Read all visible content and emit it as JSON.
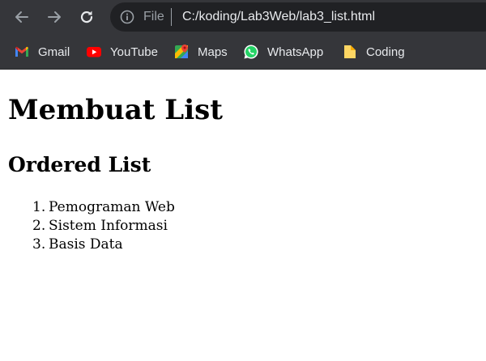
{
  "browser": {
    "scheme_label": "File",
    "url": "C:/koding/Lab3Web/lab3_list.html",
    "nav": {
      "back_icon": "arrow-left-icon",
      "forward_icon": "arrow-right-icon",
      "reload_icon": "reload-icon"
    },
    "bookmarks": [
      {
        "label": "Gmail",
        "icon": "gmail-icon"
      },
      {
        "label": "YouTube",
        "icon": "youtube-icon"
      },
      {
        "label": "Maps",
        "icon": "maps-icon"
      },
      {
        "label": "WhatsApp",
        "icon": "whatsapp-icon"
      },
      {
        "label": "Coding",
        "icon": "folder-icon"
      }
    ]
  },
  "page": {
    "heading": "Membuat List",
    "subheading": "Ordered List",
    "ordered_list": [
      {
        "number": "1.",
        "text": "Pemograman Web"
      },
      {
        "number": "2.",
        "text": "Sistem Informasi"
      },
      {
        "number": "3.",
        "text": "Basis Data"
      }
    ]
  },
  "colors": {
    "chrome_bg": "#35363a",
    "omnibox_bg": "#202124",
    "chrome_text": "#e8eaed",
    "muted_text": "#9aa0a6",
    "page_bg": "#ffffff"
  }
}
